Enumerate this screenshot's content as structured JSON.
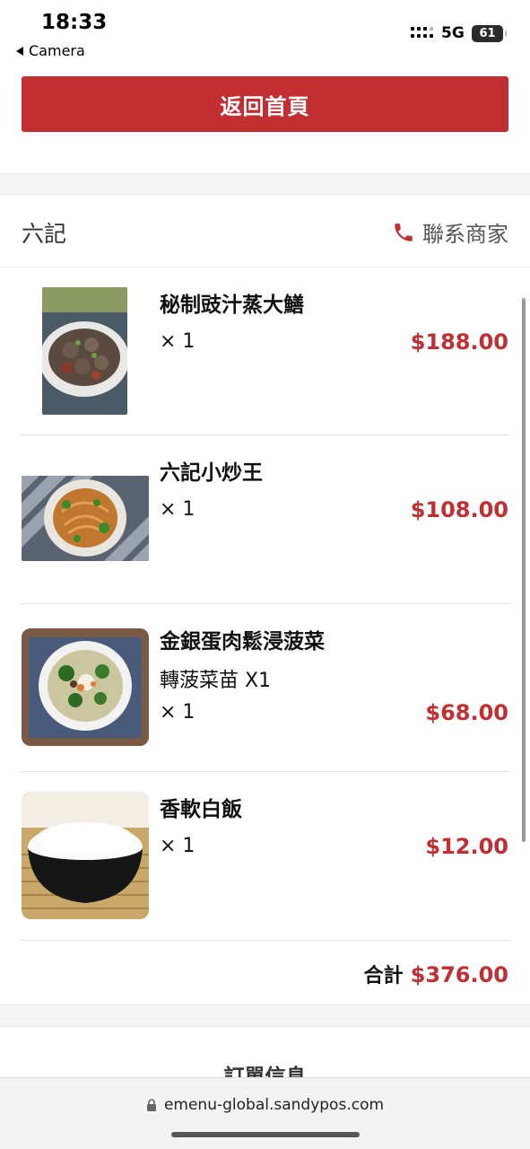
{
  "status_bar": {
    "time": "18:33",
    "back_label": "Camera",
    "network": "5G",
    "battery": "61"
  },
  "top": {
    "home_button_label": "返回首頁"
  },
  "store": {
    "name": "六記",
    "contact_label": "聯系商家",
    "items": [
      {
        "name": "秘制豉汁蒸大鱔",
        "option": "",
        "qty": "× 1",
        "price": "$188.00",
        "image": "steamed-eel-photo"
      },
      {
        "name": "六記小炒王",
        "option": "",
        "qty": "× 1",
        "price": "$108.00",
        "image": "stir-fry-noodles-photo"
      },
      {
        "name": "金銀蛋肉鬆浸菠菜",
        "option": "轉菠菜苗 X1",
        "qty": "× 1",
        "price": "$68.00",
        "image": "spinach-soup-photo"
      },
      {
        "name": "香軟白飯",
        "option": "",
        "qty": "× 1",
        "price": "$12.00",
        "image": "white-rice-photo"
      }
    ],
    "total_label": "合計",
    "total_value": "$376.00"
  },
  "order_info": {
    "title": "訂單信息"
  },
  "browser": {
    "url": "emenu-global.sandypos.com"
  },
  "colors": {
    "accent": "#c12f33",
    "background": "#f4f4f4"
  }
}
